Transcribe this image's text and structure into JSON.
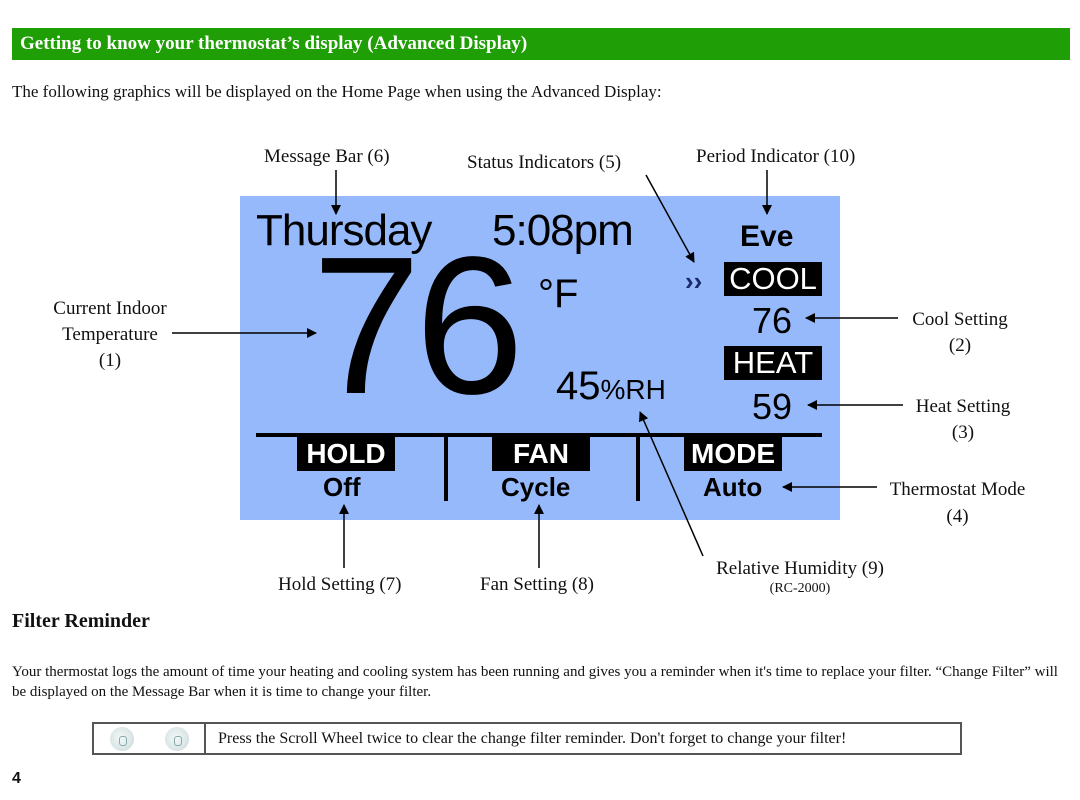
{
  "header": {
    "title": "Getting to know your thermostat’s display (Advanced Display)",
    "banner_color": "#1f9e05"
  },
  "intro": "The following graphics will be displayed on the Home Page when using the Advanced Display:",
  "callouts": {
    "message_bar": "Message Bar (6)",
    "status_indicators": "Status Indicators (5)",
    "period_indicator": "Period Indicator (10)",
    "current_temp_line1": "Current Indoor",
    "current_temp_line2": "Temperature",
    "current_temp_line3": "(1)",
    "cool_setting_line1": "Cool Setting",
    "cool_setting_line2": "(2)",
    "heat_setting_line1": "Heat Setting",
    "heat_setting_line2": "(3)",
    "mode_line1": "Thermostat Mode",
    "mode_line2": "(4)",
    "hold_setting": "Hold Setting (7)",
    "fan_setting": "Fan Setting (8)",
    "humidity_line1": "Relative Humidity (9)",
    "humidity_line2": "(RC-2000)"
  },
  "display": {
    "background_color": "#96b9fb",
    "day": "Thursday",
    "time": "5:08pm",
    "period": "Eve",
    "status_indicator": "››",
    "current_temp": "76",
    "unit": "°F",
    "cool_label": "COOL",
    "cool_setpoint": "76",
    "heat_label": "HEAT",
    "heat_setpoint": "59",
    "humidity_value": "45",
    "humidity_unit": "%RH",
    "hold_label": "HOLD",
    "hold_value": "Off",
    "fan_label": "FAN",
    "fan_value": "Cycle",
    "mode_label": "MODE",
    "mode_value": "Auto"
  },
  "filter_section": {
    "heading": "Filter Reminder",
    "paragraph": "Your thermostat logs the amount of time your heating and cooling system has been running and gives you a reminder when it's time to replace your filter.  “Change Filter” will be displayed on the Message Bar when it is time to change your filter.",
    "tip_icons": [
      "scroll-wheel-press-icon",
      "scroll-wheel-press-icon"
    ],
    "tip_text": "Press the Scroll Wheel twice to clear the change filter reminder.  Don't forget to change your filter!"
  },
  "page_number": "4"
}
